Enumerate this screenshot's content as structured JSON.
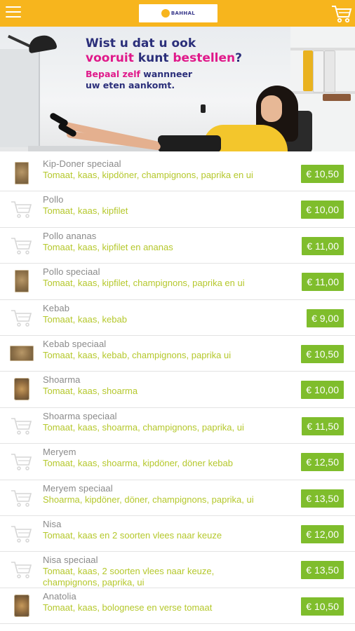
{
  "topbar": {
    "menu_icon": "hamburger-menu-icon",
    "logo_text": "BAHHAL",
    "cart_icon": "shopping-cart-icon",
    "background": "#f7b51d"
  },
  "banner": {
    "line1": "Wist u dat u ook",
    "line2_accent": "vooruit",
    "line2_mid": " kunt ",
    "line2_accent2": "bestellen",
    "line2_end": "?",
    "line3_accent": "Bepaal zelf",
    "line3_rest": " wannneer",
    "line4": "uw eten aankomt."
  },
  "colors": {
    "accent": "#f7b51d",
    "price_bg": "#7fbd2c",
    "description": "#b5c82c",
    "title": "#8a8a8a"
  },
  "items": [
    {
      "name": "Kip-Doner speciaal",
      "desc": "Tomaat, kaas, kipdöner, champignons, paprika en ui",
      "price": "€ 10,50",
      "thumb": "photo"
    },
    {
      "name": "Pollo",
      "desc": "Tomaat, kaas, kipfilet",
      "price": "€ 10,00",
      "thumb": "cart"
    },
    {
      "name": "Pollo ananas",
      "desc": "Tomaat, kaas, kipfilet en ananas",
      "price": "€ 11,00",
      "thumb": "cart"
    },
    {
      "name": "Pollo speciaal",
      "desc": "Tomaat, kaas, kipfilet, champignons, paprika en ui",
      "price": "€ 11,00",
      "thumb": "photo"
    },
    {
      "name": "Kebab",
      "desc": "Tomaat, kaas, kebab",
      "price": "€ 9,00",
      "thumb": "cart"
    },
    {
      "name": "Kebab speciaal",
      "desc": "Tomaat, kaas, kebab, champignons, paprika ui",
      "price": "€ 10,50",
      "thumb": "photo-wide"
    },
    {
      "name": "Shoarma",
      "desc": "Tomaat, kaas, shoarma",
      "price": "€ 10,00",
      "thumb": "photo-round"
    },
    {
      "name": "Shoarma speciaal",
      "desc": "Tomaat, kaas, shoarma, champignons, paprika, ui",
      "price": "€ 11,50",
      "thumb": "cart"
    },
    {
      "name": "Meryem",
      "desc": "Tomaat, kaas, shoarma, kipdöner, döner kebab",
      "price": "€ 12,50",
      "thumb": "cart"
    },
    {
      "name": "Meryem speciaal",
      "desc": "Shoarma, kipdöner, döner, champignons, paprika, ui",
      "price": "€ 13,50",
      "thumb": "cart"
    },
    {
      "name": "Nisa",
      "desc": "Tomaat, kaas en 2 soorten vlees naar keuze",
      "price": "€ 12,00",
      "thumb": "cart"
    },
    {
      "name": "Nisa speciaal",
      "desc": "Tomaat, kaas, 2 soorten vlees naar keuze, champignons, paprika, ui",
      "price": "€ 13,50",
      "thumb": "cart"
    },
    {
      "name": "Anatolia",
      "desc": "Tomaat, kaas, bolognese en verse tomaat",
      "price": "€ 10,50",
      "thumb": "photo-round"
    }
  ]
}
